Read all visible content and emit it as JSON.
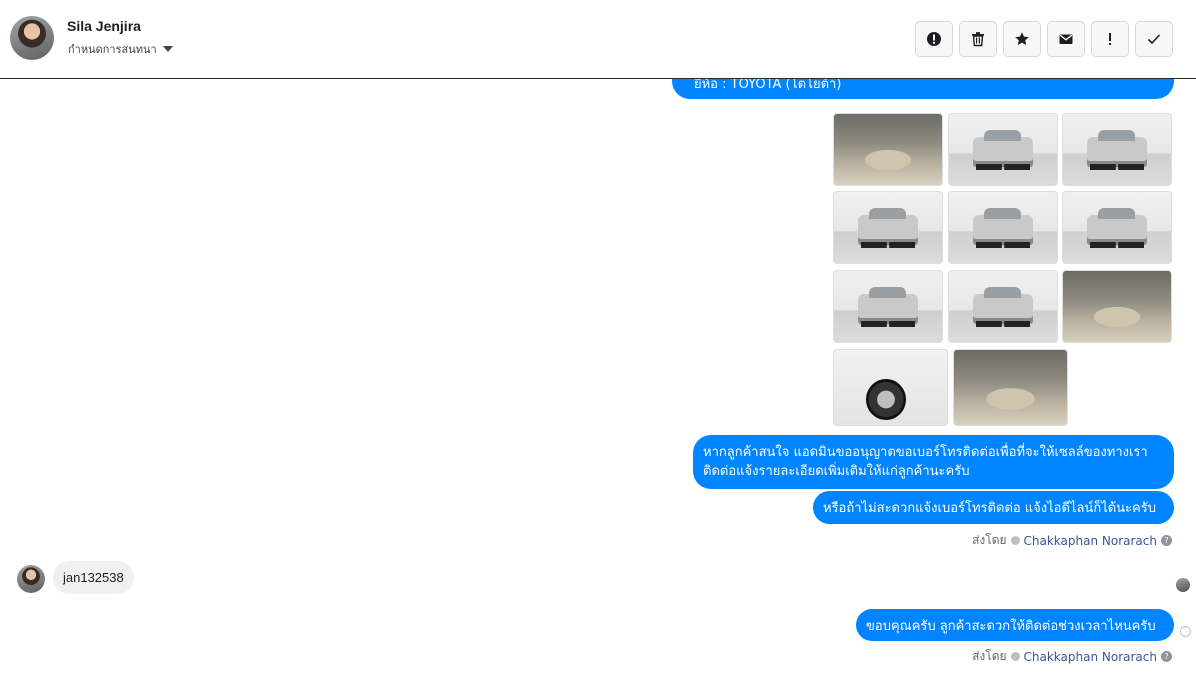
{
  "header": {
    "contact_name": "Sila Jenjira",
    "sub_action": "กำหนดการสนทนา",
    "actions": [
      {
        "name": "mark-spam-button",
        "icon": "alert-circle-icon"
      },
      {
        "name": "delete-button",
        "icon": "trash-icon"
      },
      {
        "name": "star-button",
        "icon": "star-icon"
      },
      {
        "name": "mark-unread-button",
        "icon": "envelope-icon"
      },
      {
        "name": "follow-up-button",
        "icon": "exclamation-icon"
      },
      {
        "name": "mark-done-button",
        "icon": "check-icon"
      }
    ]
  },
  "thread": {
    "top_partial": "ยี่ห้อ : TOYOTA (โตโยต้า)",
    "photos": [
      {
        "kind": "interior"
      },
      {
        "kind": "studio"
      },
      {
        "kind": "studio"
      },
      {
        "kind": "studio"
      },
      {
        "kind": "studio"
      },
      {
        "kind": "studio"
      },
      {
        "kind": "studio"
      },
      {
        "kind": "studio"
      },
      {
        "kind": "interior"
      },
      {
        "kind": "wheel"
      },
      {
        "kind": "interior"
      }
    ],
    "msg_a": "หากลูกค้าสนใจ แอดมินขออนุญาตขอเบอร์โทรติดต่อเพื่อที่จะให้เซลล์ของทางเราติดต่อแจ้งรายละเอียดเพิ่มเติมให้แก่ลูกค้านะครับ",
    "msg_b": "หรือถ้าไม่สะดวกแจ้งเบอร์โทรติดต่อ แจ้งไอดีไลน์ก็ได้นะครับ",
    "sent_by_label": "ส่งโดย",
    "sent_by_name": "Chakkaphan Norarach",
    "incoming_msg": "jan132538",
    "msg_c": "ขอบคุณครับ ลูกค้าสะดวกให้ติดต่อช่วงเวลาไหนครับ"
  },
  "colors": {
    "outgoing_bubble": "#0084ff",
    "incoming_bubble": "#f1f0f0",
    "link": "#385898"
  }
}
